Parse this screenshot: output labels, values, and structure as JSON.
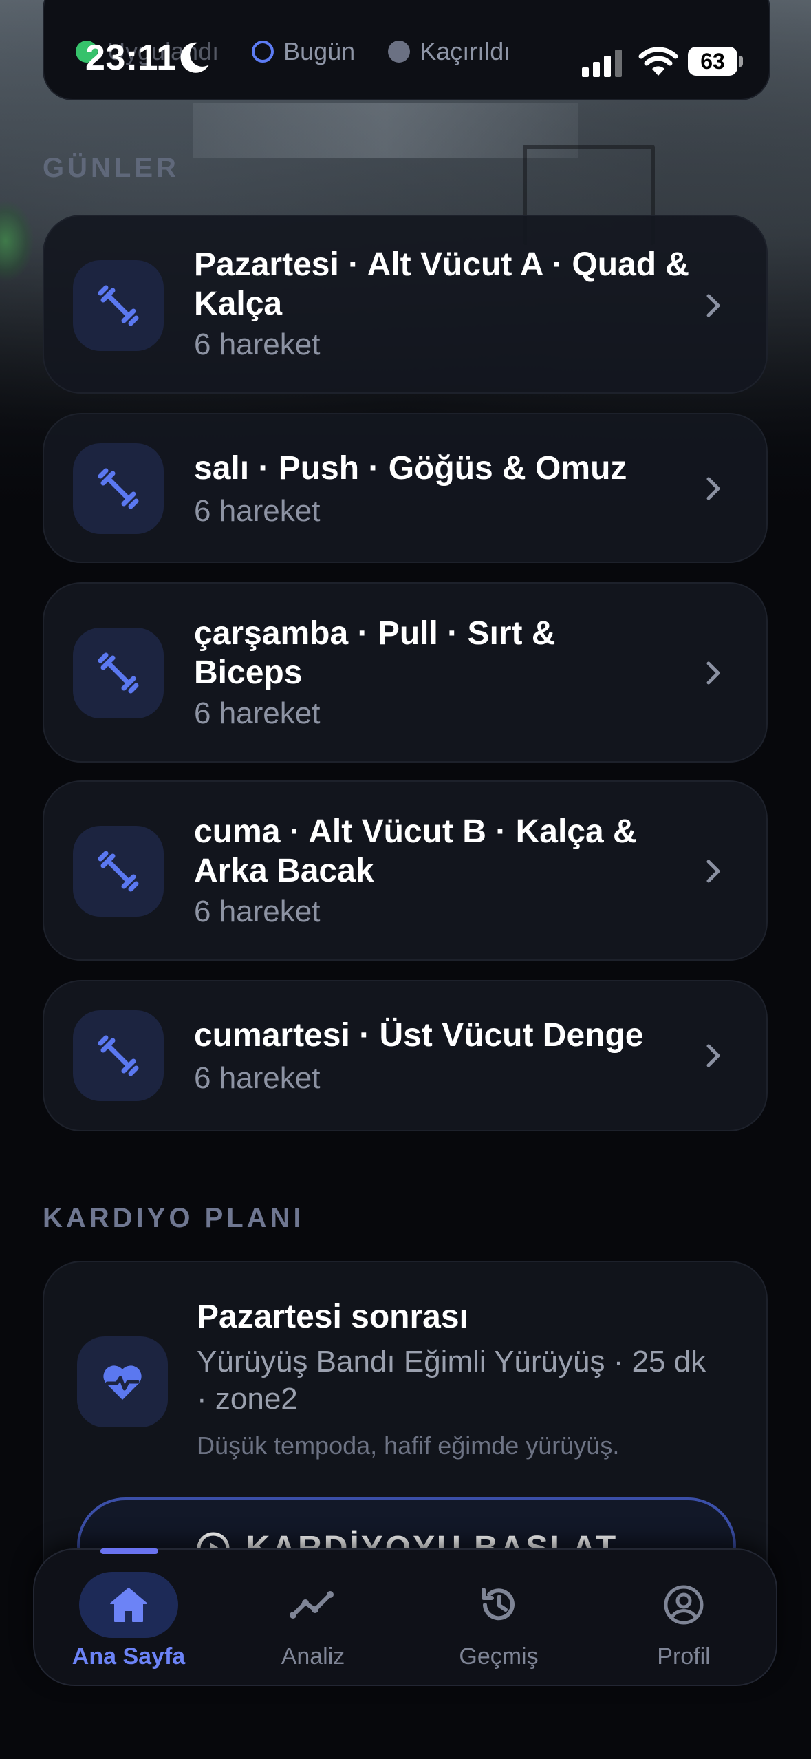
{
  "status_bar": {
    "time": "23:11",
    "battery": "63"
  },
  "legend": {
    "items": [
      {
        "label": "Uygulandı",
        "state": "done",
        "color": "#36c26b"
      },
      {
        "label": "Bugün",
        "state": "today",
        "color": "#5d7cf4"
      },
      {
        "label": "Kaçırıldı",
        "state": "missed",
        "color": "#6b7183"
      }
    ]
  },
  "days_section": {
    "title": "GÜNLER",
    "days": [
      {
        "title": "Pazartesi · Alt Vücut A · Quad & Kalça",
        "subtitle": "6 hareket",
        "icon": "dumbbell-icon"
      },
      {
        "title": "salı · Push · Göğüs & Omuz",
        "subtitle": "6 hareket",
        "icon": "dumbbell-icon"
      },
      {
        "title": "çarşamba · Pull · Sırt & Biceps",
        "subtitle": "6 hareket",
        "icon": "dumbbell-icon"
      },
      {
        "title": "cuma · Alt Vücut B · Kalça & Arka Bacak",
        "subtitle": "6 hareket",
        "icon": "dumbbell-icon"
      },
      {
        "title": "cumartesi · Üst Vücut Denge",
        "subtitle": "6 hareket",
        "icon": "dumbbell-icon"
      }
    ]
  },
  "cardio_section": {
    "title": "KARDIYO PLANI",
    "card": {
      "title": "Pazartesi sonrası",
      "description": "Yürüyüş Bandı Eğimli Yürüyüş · 25 dk · zone2",
      "note": "Düşük tempoda, hafif eğimde yürüyüş.",
      "button_label": "KARDİYOYU BAŞLAT",
      "icon": "heart-pulse-icon"
    }
  },
  "tab_bar": {
    "tabs": [
      {
        "label": "Ana Sayfa",
        "icon": "home-icon",
        "active": true
      },
      {
        "label": "Analiz",
        "icon": "chart-line-icon",
        "active": false
      },
      {
        "label": "Geçmiş",
        "icon": "history-icon",
        "active": false
      },
      {
        "label": "Profil",
        "icon": "user-circle-icon",
        "active": false
      }
    ]
  },
  "colors": {
    "accent": "#6c83f6",
    "background": "#07080c",
    "card": "#14171f"
  }
}
